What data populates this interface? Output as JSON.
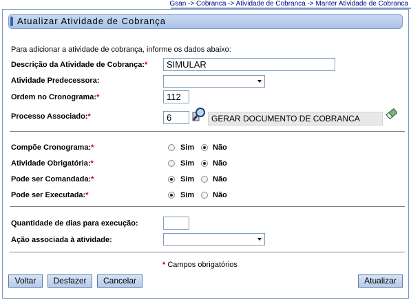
{
  "breadcrumb": "Gsan -> Cobranca -> Atividade de Cobranca -> Manter Atividade de Cobranca",
  "title": "Atualizar Atividade de Cobrança",
  "intro": "Para adicionar a atividade de cobrança, informe os dados abaixo:",
  "required_marker": "*",
  "fields": {
    "descricao": {
      "label": "Descrição da Atividade de Cobrança:",
      "value": "SIMULAR"
    },
    "predecessora": {
      "label": "Atividade Predecessora:",
      "value": ""
    },
    "ordem": {
      "label": "Ordem no Cronograma:",
      "value": "112"
    },
    "processo": {
      "label": "Processo Associado:",
      "value": "6",
      "description": "GERAR DOCUMENTO DE COBRANCA"
    },
    "quantidade_dias": {
      "label": "Quantidade de dias para execução:",
      "value": ""
    },
    "acao": {
      "label": "Ação associada à atividade:",
      "value": ""
    }
  },
  "radio_options": {
    "sim": "Sim",
    "nao": "Não"
  },
  "radios": {
    "compoe": {
      "label": "Compõe Cronograma:",
      "selected": "nao"
    },
    "obrigatoria": {
      "label": "Atividade Obrigatória:",
      "selected": "nao"
    },
    "comandada": {
      "label": "Pode ser Comandada:",
      "selected": "sim"
    },
    "executada": {
      "label": "Pode ser Executada:",
      "selected": "sim"
    }
  },
  "required_note": "Campos obrigatórios",
  "buttons": {
    "voltar": "Voltar",
    "desfazer": "Desfazer",
    "cancelar": "Cancelar",
    "atualizar": "Atualizar"
  },
  "icons": {
    "search": "magnifier-icon",
    "clear": "eraser-icon"
  }
}
